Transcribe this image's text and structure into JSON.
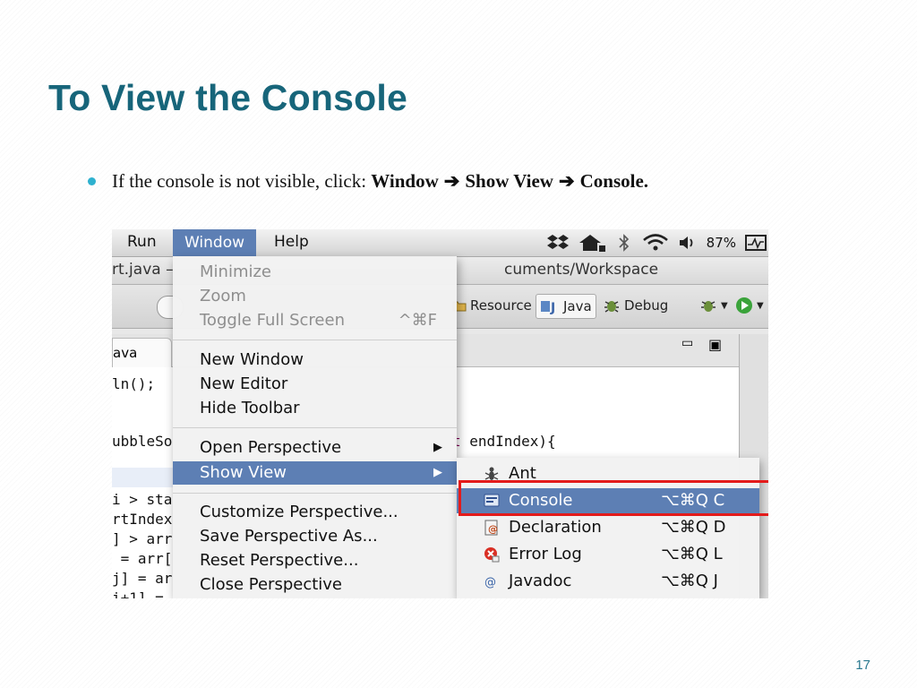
{
  "slide": {
    "title": "To View the Console",
    "bullet_text": "If the console is not visible, click:",
    "path": [
      "Window",
      "Show View",
      "Console."
    ],
    "page_number": "17"
  },
  "menubar": {
    "items": [
      "Run",
      "Window",
      "Help"
    ],
    "active": "Window",
    "battery": "87%"
  },
  "titlebar": {
    "left_text": "rt.java –",
    "right_text": "cuments/Workspace"
  },
  "toolbar": {
    "perspectives": [
      "Resource",
      "Java",
      "Debug"
    ],
    "selected": "Java"
  },
  "editor": {
    "tab_label": "ava",
    "code_lines": [
      "ln();",
      "ubbleSo",
      "i > sta",
      "rtIndex",
      "] > arr",
      " = arr[",
      "j] = ar",
      "i+1] ="
    ],
    "code_fragment_keyword": "t",
    "code_fragment_rest": " endIndex){"
  },
  "window_menu": {
    "items": [
      {
        "label": "Minimize",
        "shortcut": "",
        "disabled": true
      },
      {
        "label": "Zoom",
        "shortcut": "",
        "disabled": true
      },
      {
        "label": "Toggle Full Screen",
        "shortcut": "^⌘F",
        "disabled": true
      },
      {
        "label": "New Window",
        "shortcut": "",
        "disabled": false
      },
      {
        "label": "New Editor",
        "shortcut": "",
        "disabled": false
      },
      {
        "label": "Hide Toolbar",
        "shortcut": "",
        "disabled": false
      },
      {
        "label": "Open Perspective",
        "shortcut": "",
        "disabled": false,
        "submenu": true
      },
      {
        "label": "Show View",
        "shortcut": "",
        "disabled": false,
        "submenu": true,
        "highlighted": true
      },
      {
        "label": "Customize Perspective...",
        "shortcut": "",
        "disabled": false
      },
      {
        "label": "Save Perspective As...",
        "shortcut": "",
        "disabled": false
      },
      {
        "label": "Reset Perspective...",
        "shortcut": "",
        "disabled": false
      },
      {
        "label": "Close Perspective",
        "shortcut": "",
        "disabled": false
      }
    ]
  },
  "show_view_menu": {
    "items": [
      {
        "label": "Ant",
        "shortcut": "",
        "icon": "ant-icon"
      },
      {
        "label": "Console",
        "shortcut": "⌥⌘Q C",
        "icon": "console-icon",
        "highlighted": true
      },
      {
        "label": "Declaration",
        "shortcut": "⌥⌘Q D",
        "icon": "declaration-icon"
      },
      {
        "label": "Error Log",
        "shortcut": "⌥⌘Q L",
        "icon": "error-log-icon"
      },
      {
        "label": "Javadoc",
        "shortcut": "⌥⌘Q J",
        "icon": "javadoc-icon"
      }
    ]
  },
  "colors": {
    "title": "#17657a",
    "bullet": "#2eb1cf",
    "menu_highlight": "#5d7fb4",
    "annotation_box": "#e31b1b"
  }
}
